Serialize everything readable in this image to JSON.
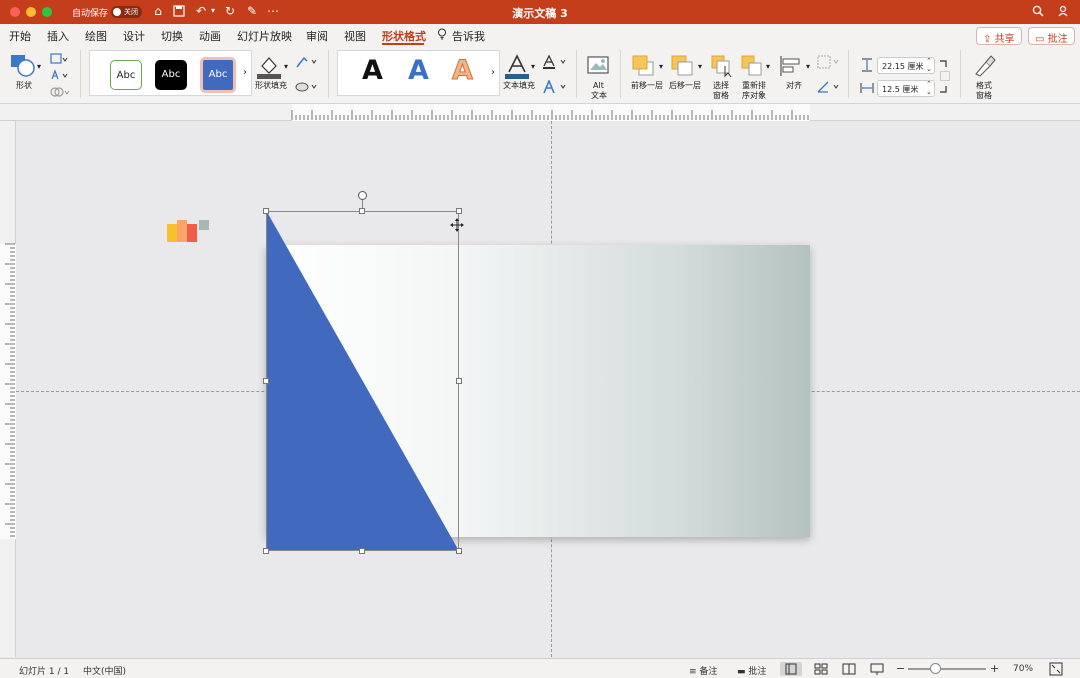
{
  "titlebar": {
    "autosave_label": "自动保存",
    "autosave_state": "关闭",
    "doc_title": "演示文稿 3"
  },
  "tabs": [
    "开始",
    "插入",
    "绘图",
    "设计",
    "切换",
    "动画",
    "幻灯片放映",
    "审阅",
    "视图",
    "形状格式"
  ],
  "active_tab": "形状格式",
  "tell_me": "告诉我",
  "share_label": "共享",
  "comments_label": "批注",
  "ribbon": {
    "shape_label": "形状",
    "style_samples": [
      "Abc",
      "Abc",
      "Abc"
    ],
    "shape_fill_label": "形状填充",
    "wordart_letter": "A",
    "text_fill_label": "文本填充",
    "alt_text_label_1": "Alt",
    "alt_text_label_2": "文本",
    "bring_forward_label": "前移一层",
    "send_backward_label": "后移一层",
    "selection_pane_label_1": "选择",
    "selection_pane_label_2": "窗格",
    "reorder_label_1": "重新排",
    "reorder_label_2": "序对象",
    "align_label": "对齐",
    "height_value": "22.15 厘米",
    "width_value": "12.5 厘米",
    "format_pane_label_1": "格式",
    "format_pane_label_2": "窗格"
  },
  "status": {
    "slide_indicator": "幻灯片 1 / 1",
    "language": "中文(中国)",
    "notes_label": "备注",
    "comments_label": "批注",
    "zoom": "70%"
  },
  "colors": {
    "accent": "#c43e1c",
    "triangle": "#4169be",
    "gradient_end": "#b4c2bf"
  }
}
